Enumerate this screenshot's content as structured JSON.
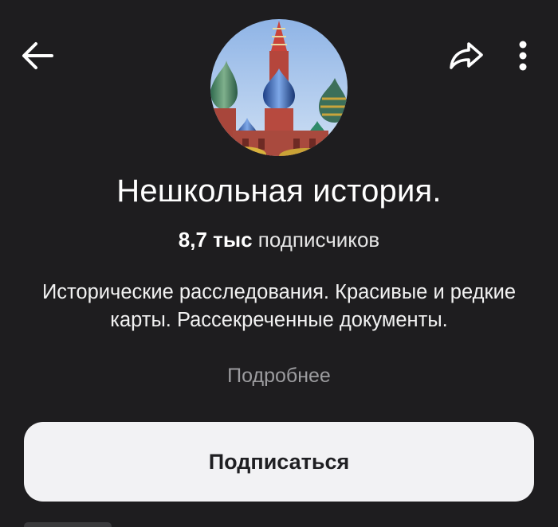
{
  "header": {
    "back_icon": "arrow-left-icon",
    "share_icon": "share-arrow-icon",
    "more_icon": "vertical-dots-icon"
  },
  "channel": {
    "avatar_icon": "st-basils-cathedral-image",
    "title": "Нешкольная история.",
    "subscribers_count": "8,7 тыс",
    "subscribers_label": "подписчиков",
    "description": "Исторические расследования. Красивые и редкие карты. Рассекреченные документы.",
    "more_link": "Подробнее",
    "subscribe_label": "Подписаться"
  },
  "colors": {
    "background": "#1e1d1f",
    "button_bg": "#f2f2f4",
    "button_text": "#1f1f22",
    "muted_text": "#9c9c9f"
  }
}
